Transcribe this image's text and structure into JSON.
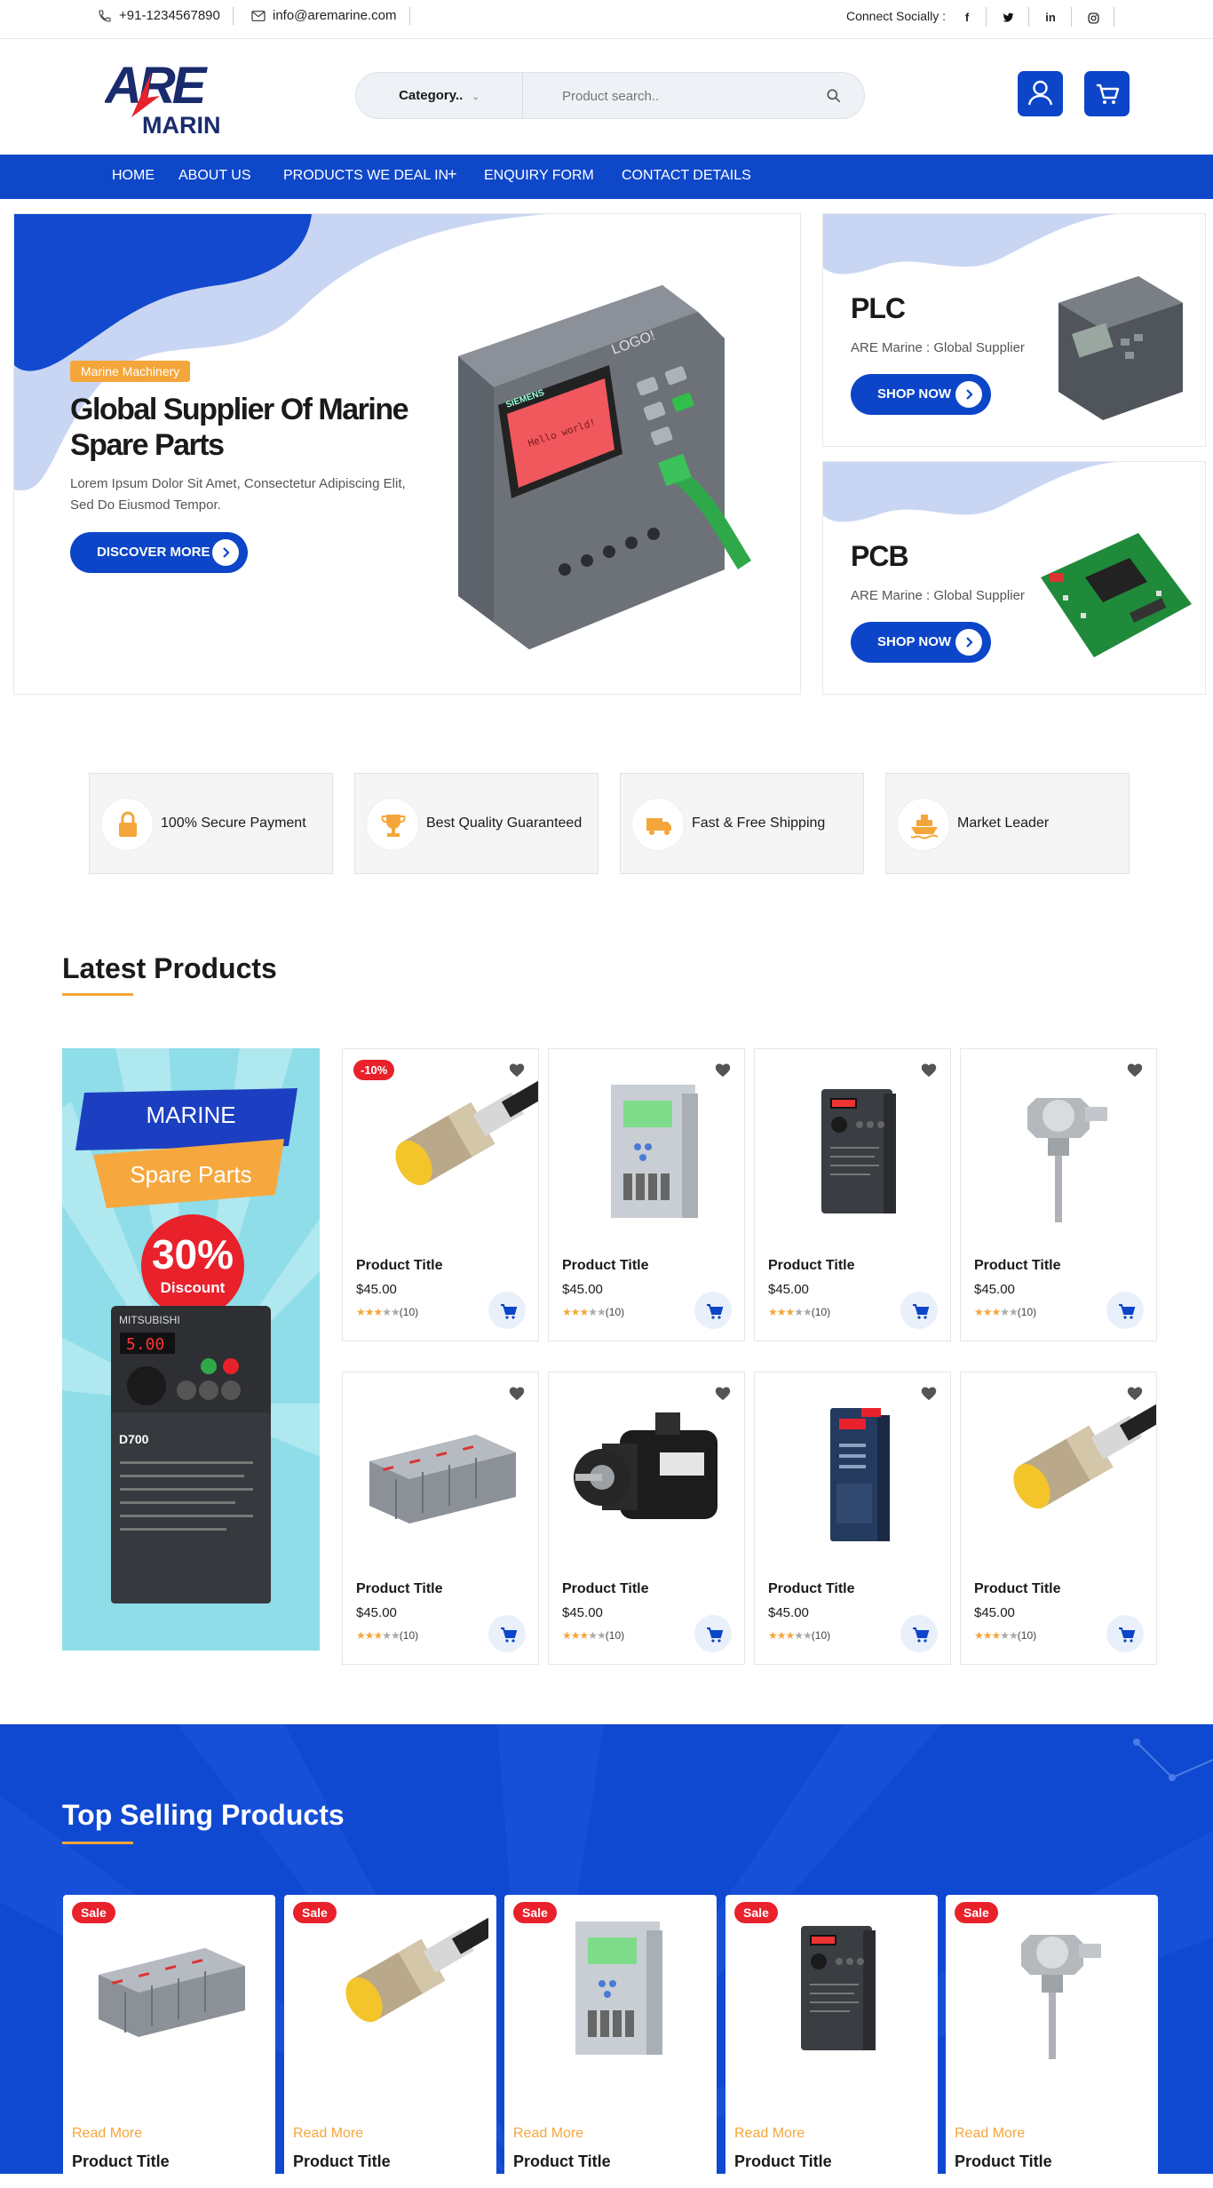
{
  "topbar": {
    "phone": "+91-1234567890",
    "email": "info@aremarine.com",
    "social_label": "Connect Socially :",
    "social": [
      "f",
      "twitter-icon",
      "in",
      "instagram-icon"
    ]
  },
  "header": {
    "logo_top": "ARE",
    "logo_bottom": "MARINE",
    "category_label": "Category..",
    "search_placeholder": "Product search.."
  },
  "nav": {
    "items": [
      "HOME",
      "ABOUT US",
      "PRODUCTS WE DEAL IN",
      "ENQUIRY FORM",
      "CONTACT DETAILS"
    ],
    "plus": "+"
  },
  "hero": {
    "badge": "Marine Machinery",
    "title_line1": "Global Supplier Of Marine",
    "title_line2": "Spare Parts",
    "desc_line1": "Lorem Ipsum Dolor Sit Amet, Consectetur Adipiscing Elit,",
    "desc_line2": "Sed Do Eiusmod Tempor.",
    "button": "DISCOVER MORE",
    "device_brand": "SIEMENS",
    "device_logo": "LOGO!",
    "device_screen": "Hello world!"
  },
  "side_banners": [
    {
      "title": "PLC",
      "subtitle": "ARE Marine : Global Supplier",
      "button": "SHOP NOW"
    },
    {
      "title": "PCB",
      "subtitle": "ARE Marine : Global Supplier",
      "button": "SHOP NOW"
    }
  ],
  "features": [
    {
      "label": "100% Secure Payment",
      "icon": "lock-icon"
    },
    {
      "label": "Best Quality Guaranteed",
      "icon": "trophy-icon"
    },
    {
      "label": "Fast & Free Shipping",
      "icon": "truck-icon"
    },
    {
      "label": "Market Leader",
      "icon": "ship-icon"
    }
  ],
  "latest": {
    "title": "Latest Products",
    "promo": {
      "line1": "MARINE",
      "line2": "Spare Parts",
      "percent": "30%",
      "discount": "Discount",
      "inverter_brand": "MITSUBISHI",
      "inverter_model": "D700",
      "inverter_display": "5.00"
    },
    "products": [
      {
        "title": "Product Title",
        "price": "$45.00",
        "count": "(10)",
        "discount": "-10%",
        "image": "sensor"
      },
      {
        "title": "Product Title",
        "price": "$45.00",
        "count": "(10)",
        "discount": "",
        "image": "relay"
      },
      {
        "title": "Product Title",
        "price": "$45.00",
        "count": "(10)",
        "discount": "",
        "image": "inverter"
      },
      {
        "title": "Product Title",
        "price": "$45.00",
        "count": "(10)",
        "discount": "",
        "image": "thermo"
      },
      {
        "title": "Product Title",
        "price": "$45.00",
        "count": "(10)",
        "discount": "",
        "image": "plcrack"
      },
      {
        "title": "Product Title",
        "price": "$45.00",
        "count": "(10)",
        "discount": "",
        "image": "servo"
      },
      {
        "title": "Product Title",
        "price": "$45.00",
        "count": "(10)",
        "discount": "",
        "image": "drive"
      },
      {
        "title": "Product Title",
        "price": "$45.00",
        "count": "(10)",
        "discount": "",
        "image": "sensor"
      }
    ]
  },
  "top_selling": {
    "title": "Top Selling Products",
    "items": [
      {
        "sale": "Sale",
        "read_more": "Read More",
        "title": "Product Title",
        "image": "plcrack"
      },
      {
        "sale": "Sale",
        "read_more": "Read More",
        "title": "Product Title",
        "image": "sensor"
      },
      {
        "sale": "Sale",
        "read_more": "Read More",
        "title": "Product Title",
        "image": "relay"
      },
      {
        "sale": "Sale",
        "read_more": "Read More",
        "title": "Product Title",
        "image": "inverter"
      },
      {
        "sale": "Sale",
        "read_more": "Read More",
        "title": "Product Title",
        "image": "thermo"
      }
    ]
  },
  "colors": {
    "brand_blue": "#0c45c7",
    "accent_orange": "#f5a63a",
    "sale_red": "#e8212b"
  }
}
